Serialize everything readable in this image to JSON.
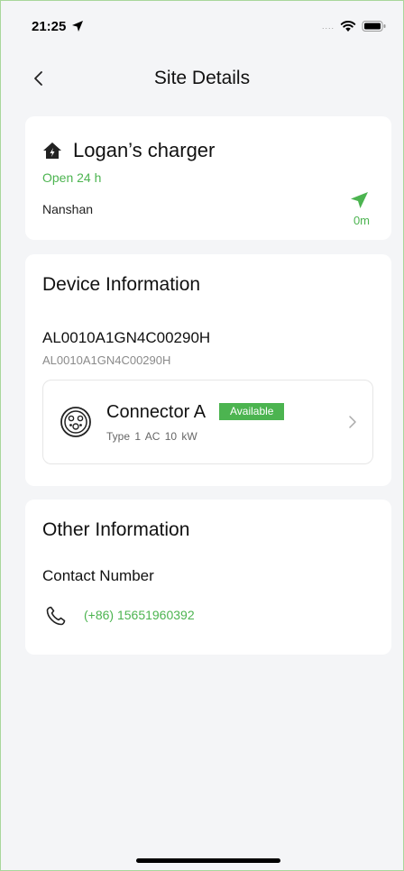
{
  "status_bar": {
    "time": "21:25",
    "signal": "....",
    "icons": [
      "location-arrow-icon",
      "wifi-icon",
      "battery-icon"
    ]
  },
  "nav": {
    "title": "Site Details",
    "back_icon": "chevron-left-icon"
  },
  "site": {
    "name": "Logan’s charger",
    "hours": "Open 24 h",
    "district": "Nanshan",
    "distance": "0m",
    "icon": "home-charger-icon"
  },
  "device": {
    "section_title": "Device Information",
    "id": "AL0010A1GN4C00290H",
    "id_sub": "AL0010A1GN4C00290H",
    "connector": {
      "name": "Connector A",
      "status": "Available",
      "specs": "Type 1  AC  10 kW",
      "icon": "type1-plug-icon"
    }
  },
  "other": {
    "section_title": "Other Information",
    "contact_label": "Contact Number",
    "phone": "(+86) 15651960392"
  },
  "colors": {
    "accent": "#4cb450",
    "background": "#f4f5f7",
    "card": "#ffffff"
  }
}
